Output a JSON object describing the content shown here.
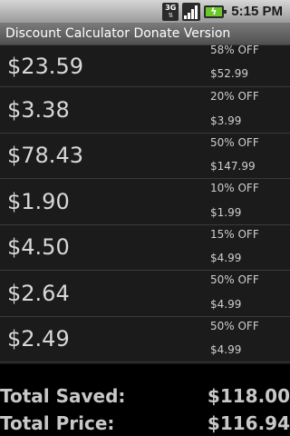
{
  "status_bar": {
    "network": "3G",
    "time": "5:15 PM"
  },
  "title": "Discount Calculator Donate Version",
  "items": [
    {
      "price": "$23.59",
      "discount": "58% OFF",
      "original": "$52.99"
    },
    {
      "price": "$3.38",
      "discount": "20% OFF",
      "original": "$3.99"
    },
    {
      "price": "$78.43",
      "discount": "50% OFF",
      "original": "$147.99"
    },
    {
      "price": "$1.90",
      "discount": "10% OFF",
      "original": "$1.99"
    },
    {
      "price": "$4.50",
      "discount": "15% OFF",
      "original": "$4.99"
    },
    {
      "price": "$2.64",
      "discount": "50% OFF",
      "original": "$4.99"
    },
    {
      "price": "$2.49",
      "discount": "50% OFF",
      "original": "$4.99"
    }
  ],
  "totals": {
    "saved_label": "Total Saved:",
    "saved_value": "$118.00",
    "price_label": "Total Price:",
    "price_value": "$116.94"
  },
  "colors": {
    "status_bar": "#b0b0b0",
    "title_bar": "#606060",
    "list_bg": "#1b1b1b",
    "battery": "#6cc72a"
  }
}
